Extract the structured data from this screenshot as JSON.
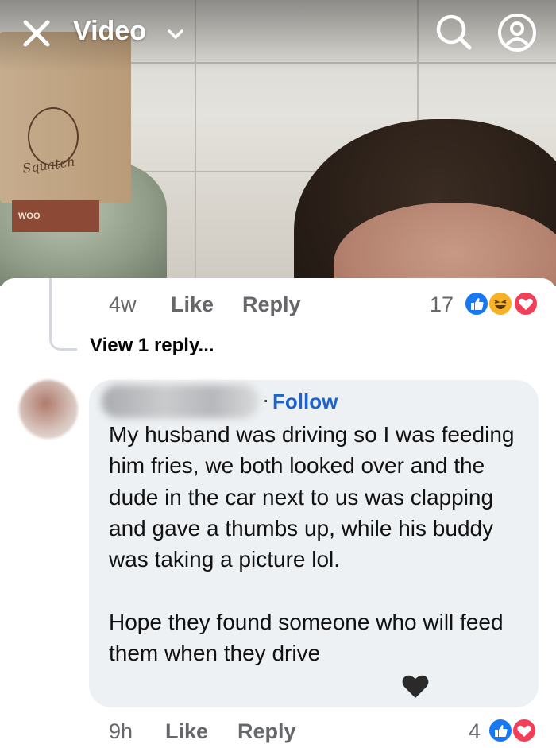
{
  "header": {
    "title": "Video",
    "icons": {
      "close": "close-icon",
      "dropdown": "chevron-down-icon",
      "search": "search-icon",
      "profile": "profile-icon"
    }
  },
  "video": {
    "product_label": "Squatch",
    "band_text": "WOO"
  },
  "previous_comment": {
    "time": "4w",
    "like_label": "Like",
    "reply_label": "Reply",
    "reaction_count": "17",
    "reactions": [
      "like",
      "haha",
      "love"
    ]
  },
  "view_replies": "View 1 reply...",
  "comment": {
    "author_hidden": true,
    "follow_label": "Follow",
    "text": "My husband was driving so I was feeding him fries, we both looked over and the dude in the car next to us was clapping and gave a thumbs up, while his buddy was taking a picture lol.\n\nHope they found someone who will feed them when they drive",
    "emoji": "black-heart",
    "time": "9h",
    "like_label": "Like",
    "reply_label": "Reply",
    "reaction_count": "4",
    "reactions": [
      "like",
      "love"
    ]
  },
  "colors": {
    "link_blue": "#1b63d0",
    "meta_gray": "#65676b",
    "bubble_bg": "#eef1f3",
    "like_blue": "#1877f2",
    "love_red": "#f33e58",
    "haha_yellow": "#f7b125"
  }
}
